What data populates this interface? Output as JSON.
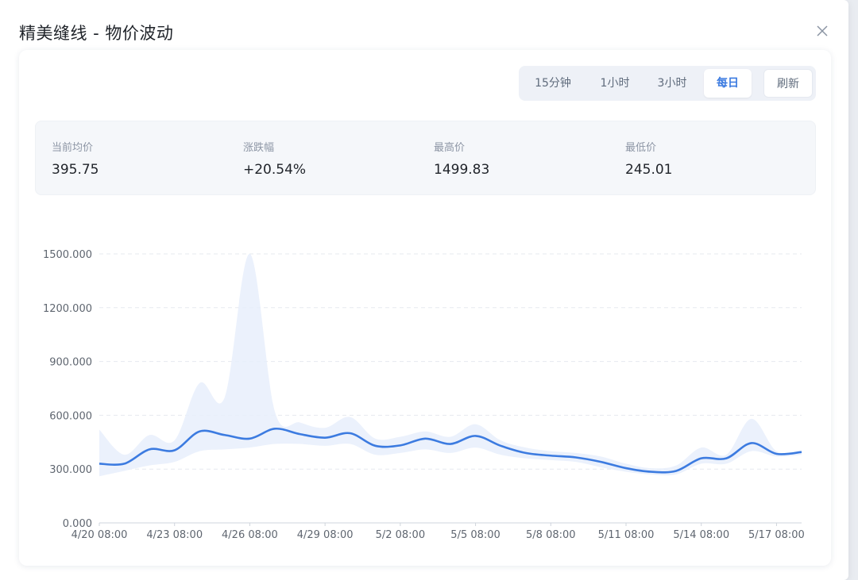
{
  "dialog": {
    "title": "精美缝线 - 物价波动"
  },
  "ranges": [
    {
      "label": "15分钟",
      "active": false
    },
    {
      "label": "1小时",
      "active": false
    },
    {
      "label": "3小时",
      "active": false
    },
    {
      "label": "每日",
      "active": true
    }
  ],
  "refresh_label": "刷新",
  "stats": [
    {
      "label": "当前均价",
      "value": "395.75"
    },
    {
      "label": "涨跌幅",
      "value": "+20.54%"
    },
    {
      "label": "最高价",
      "value": "1499.83"
    },
    {
      "label": "最低价",
      "value": "245.01"
    }
  ],
  "colors": {
    "line": "#3c7be0",
    "band": "#e7effc",
    "accent": "#3c7be0"
  },
  "chart_data": {
    "type": "area",
    "ylim": [
      0,
      1500
    ],
    "yticks": [
      "0.000",
      "300.000",
      "600.000",
      "900.000",
      "1200.000",
      "1500.000"
    ],
    "yticks_values": [
      0,
      300,
      600,
      900,
      1200,
      1500
    ],
    "xticks": [
      "4/20 08:00",
      "4/23 08:00",
      "4/26 08:00",
      "4/29 08:00",
      "5/2 08:00",
      "5/5 08:00",
      "5/8 08:00",
      "5/11 08:00",
      "5/14 08:00",
      "5/17 08:00"
    ],
    "x_start": "4/20 08:00",
    "x_step_days": 1,
    "grid": true,
    "series": [
      {
        "values": [
          330,
          330,
          410,
          405,
          510,
          490,
          470,
          525,
          495,
          475,
          500,
          430,
          432,
          470,
          440,
          485,
          430,
          390,
          375,
          365,
          340,
          305,
          285,
          290,
          360,
          360,
          445,
          385,
          395
        ]
      },
      {
        "type": "range_band",
        "low": [
          260,
          290,
          320,
          340,
          400,
          410,
          420,
          440,
          440,
          430,
          440,
          380,
          390,
          410,
          390,
          420,
          380,
          360,
          350,
          340,
          310,
          285,
          270,
          270,
          330,
          330,
          400,
          370,
          380
        ],
        "high": [
          520,
          380,
          490,
          460,
          780,
          700,
          1499.83,
          620,
          560,
          530,
          590,
          470,
          480,
          510,
          480,
          550,
          460,
          420,
          400,
          390,
          370,
          330,
          305,
          320,
          420,
          380,
          580,
          400,
          400
        ]
      }
    ]
  }
}
